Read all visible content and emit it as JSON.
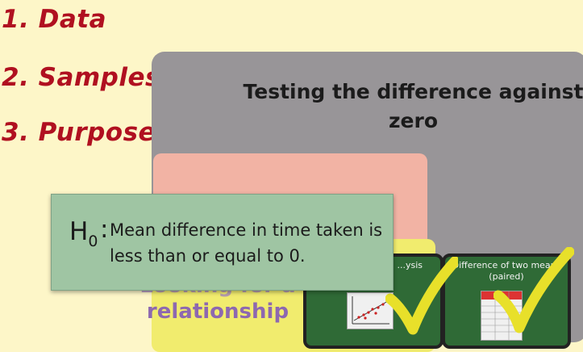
{
  "steps": [
    {
      "label": "1.  Data"
    },
    {
      "label": "2.  Samples"
    },
    {
      "label": "3.  Purpose"
    }
  ],
  "grey_panel": {
    "title": "Testing the difference against zero"
  },
  "yellow_panel": {
    "label_line1": "Looking for a",
    "label_line2": "relationship"
  },
  "cards": [
    {
      "title": "...ysis"
    },
    {
      "title": "Difference of two means (paired)"
    }
  ],
  "hypothesis": {
    "symbol": "H",
    "subscript": "0",
    "colon": ":",
    "text": "Mean difference in time taken is less than or equal to 0."
  },
  "icons": [
    "check-icon",
    "scatter-plot-icon",
    "table-icon"
  ],
  "colors": {
    "background": "#fdf6c8",
    "step_text": "#b01020",
    "grey_panel": "#989598",
    "pink_panel": "#f2b3a4",
    "yellow_panel": "#f1ec6e",
    "hypothesis_box": "#9fc5a3",
    "check": "#e8e02a"
  }
}
